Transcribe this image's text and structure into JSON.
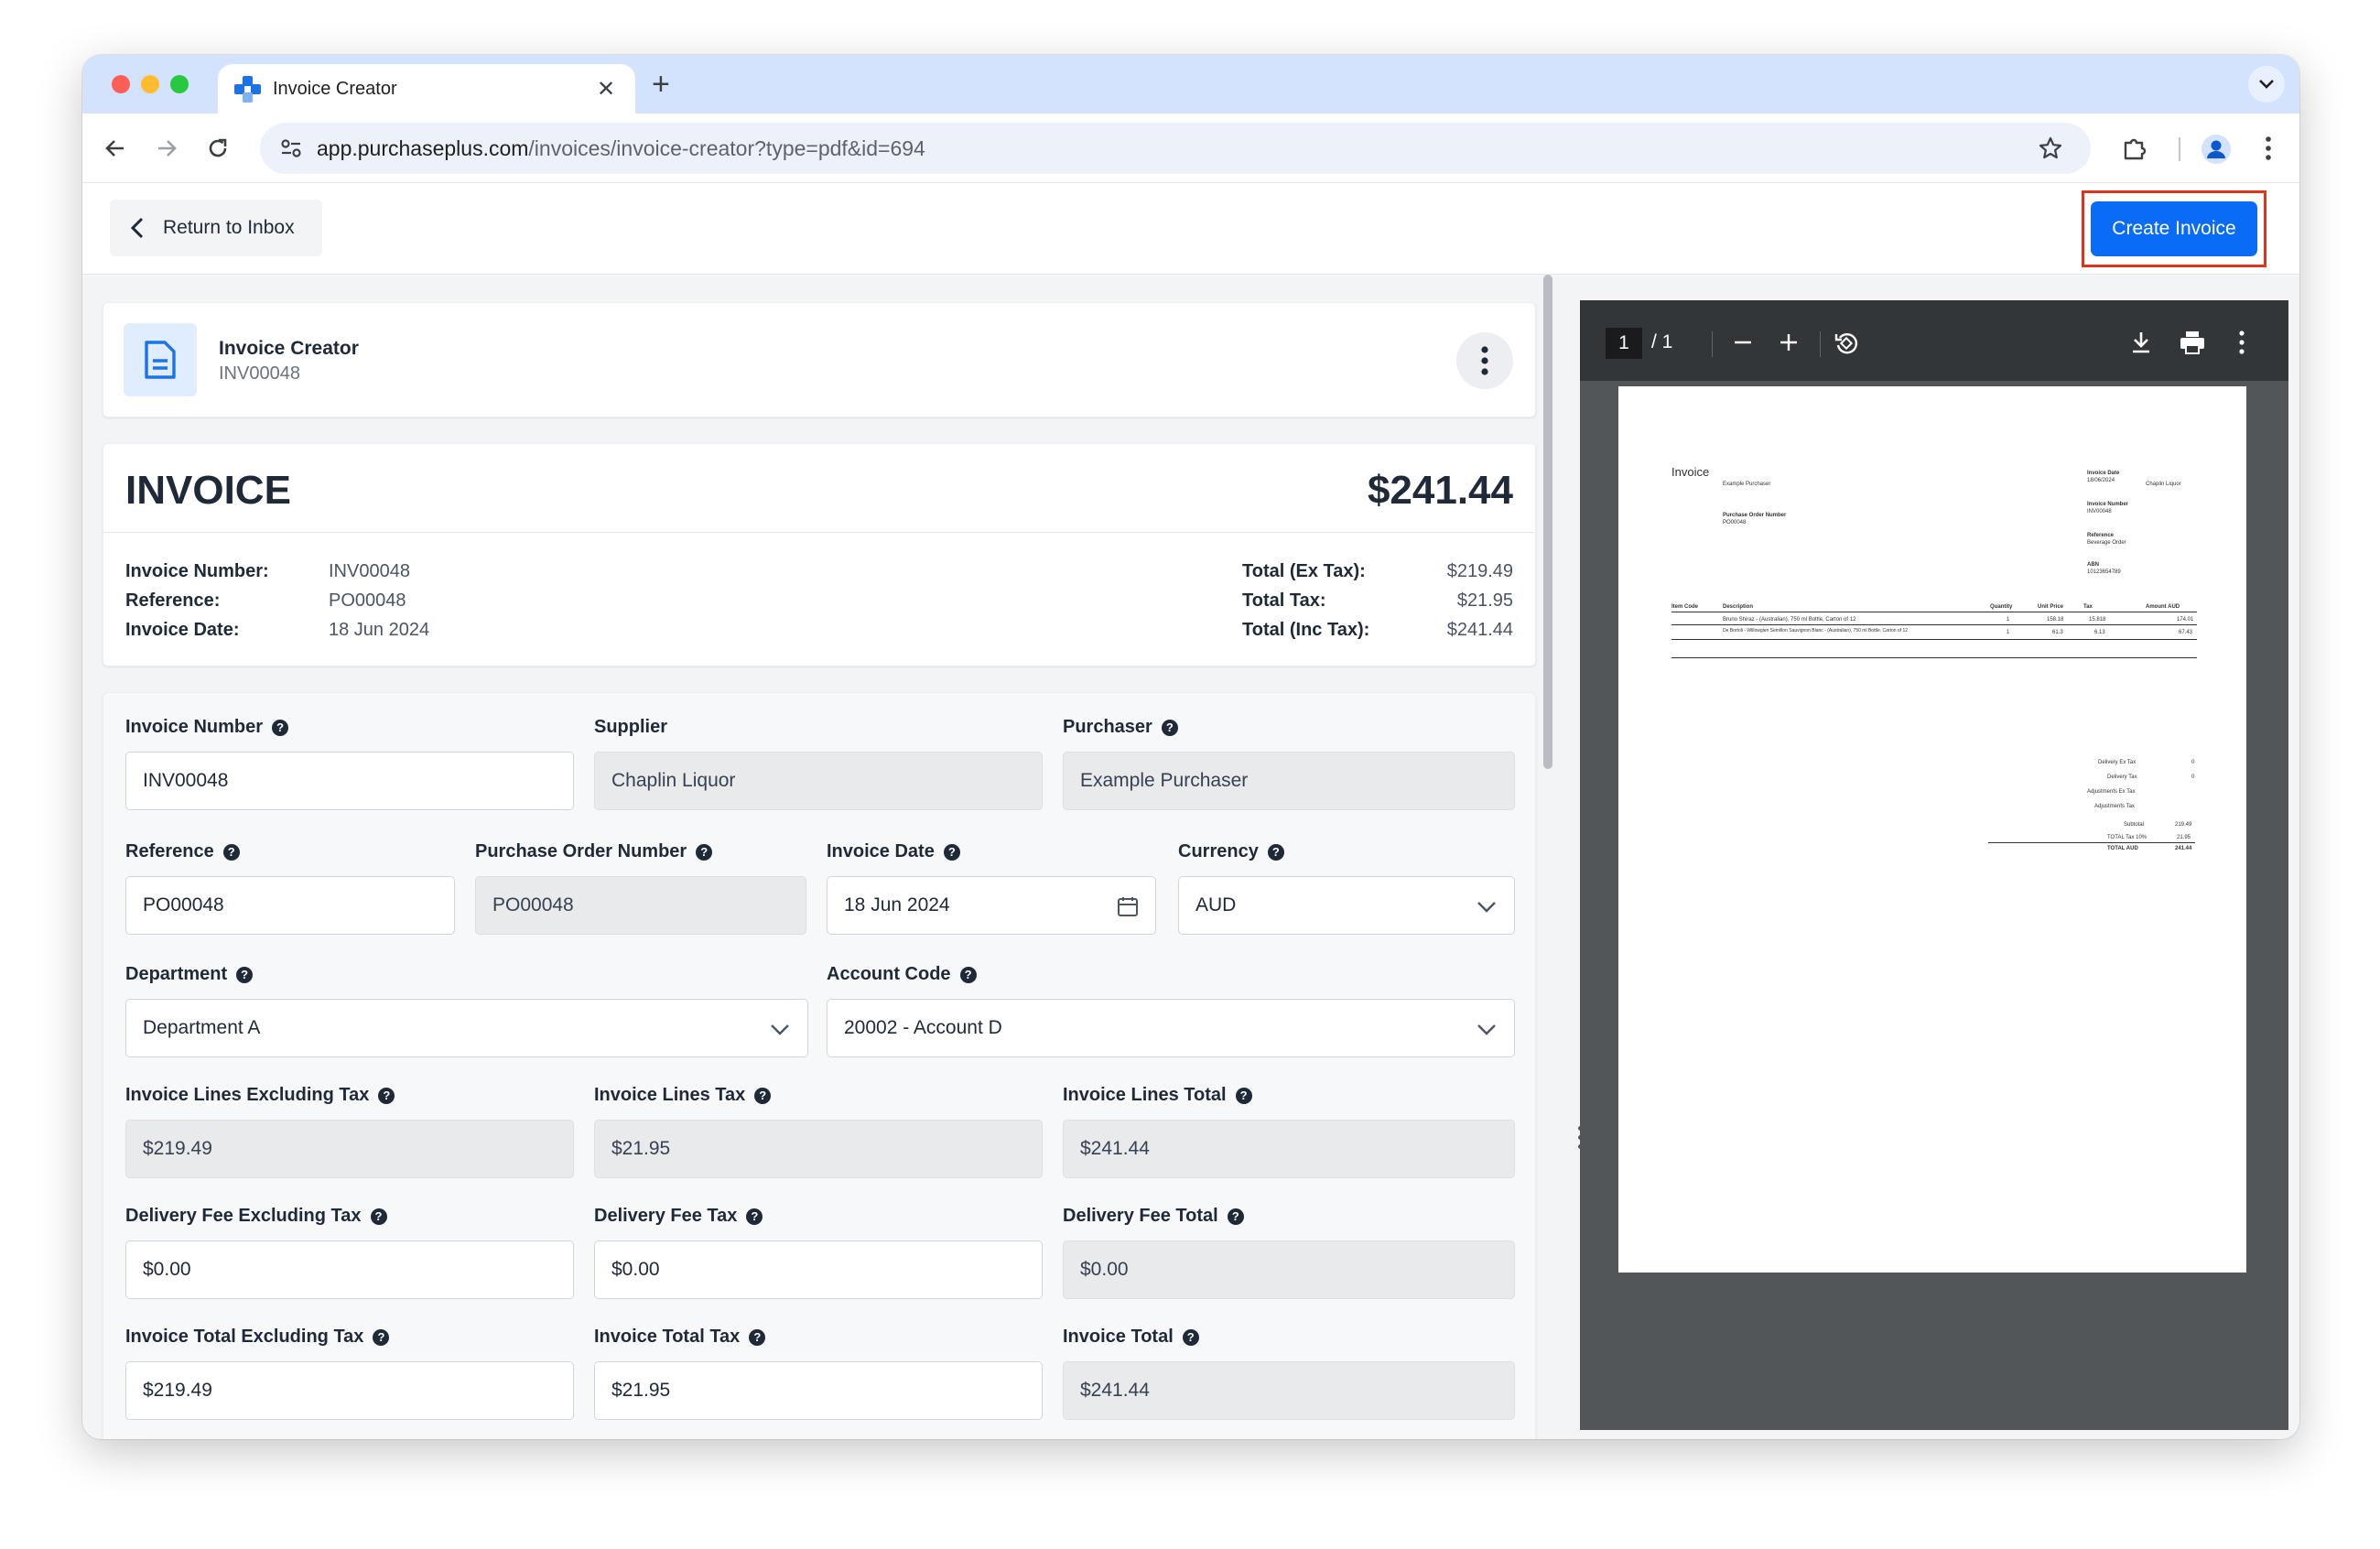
{
  "browser": {
    "tab_title": "Invoice Creator",
    "url_host": "app.purchaseplus.com",
    "url_path": "/invoices/invoice-creator?type=pdf&id=694"
  },
  "header": {
    "return_label": "Return to Inbox",
    "create_label": "Create Invoice"
  },
  "invoice_header": {
    "title": "Invoice Creator",
    "subtitle": "INV00048"
  },
  "summary": {
    "title": "INVOICE",
    "total": "$241.44",
    "left": [
      {
        "label": "Invoice Number:",
        "value": "INV00048"
      },
      {
        "label": "Reference:",
        "value": "PO00048"
      },
      {
        "label": "Invoice Date:",
        "value": "18 Jun 2024"
      }
    ],
    "right": [
      {
        "label": "Total (Ex Tax):",
        "value": "$219.49"
      },
      {
        "label": "Total Tax:",
        "value": "$21.95"
      },
      {
        "label": "Total (Inc Tax):",
        "value": "$241.44"
      }
    ]
  },
  "form": {
    "invoice_number": {
      "label": "Invoice Number",
      "value": "INV00048"
    },
    "supplier": {
      "label": "Supplier",
      "value": "Chaplin Liquor"
    },
    "purchaser": {
      "label": "Purchaser",
      "value": "Example Purchaser"
    },
    "reference": {
      "label": "Reference",
      "value": "PO00048"
    },
    "po_number": {
      "label": "Purchase Order Number",
      "value": "PO00048"
    },
    "invoice_date": {
      "label": "Invoice Date",
      "value": "18 Jun 2024"
    },
    "currency": {
      "label": "Currency",
      "value": "AUD"
    },
    "department": {
      "label": "Department",
      "value": "Department A"
    },
    "account_code": {
      "label": "Account Code",
      "value": "20002 - Account D"
    },
    "lines_ex_tax": {
      "label": "Invoice Lines Excluding Tax",
      "value": "$219.49"
    },
    "lines_tax": {
      "label": "Invoice Lines Tax",
      "value": "$21.95"
    },
    "lines_total": {
      "label": "Invoice Lines Total",
      "value": "$241.44"
    },
    "delivery_ex_tax": {
      "label": "Delivery Fee Excluding Tax",
      "value": "$0.00"
    },
    "delivery_tax": {
      "label": "Delivery Fee Tax",
      "value": "$0.00"
    },
    "delivery_total": {
      "label": "Delivery Fee Total",
      "value": "$0.00"
    },
    "total_ex_tax": {
      "label": "Invoice Total Excluding Tax",
      "value": "$219.49"
    },
    "total_tax": {
      "label": "Invoice Total Tax",
      "value": "$21.95"
    },
    "total": {
      "label": "Invoice Total",
      "value": "$241.44"
    }
  },
  "pdf": {
    "page_current": "1",
    "page_total": "/ 1",
    "doc": {
      "title": "Invoice",
      "purchaser": "Example Purchaser",
      "po_label": "Purchase Order Number",
      "po_value": "PO00048",
      "date_label": "Invoice Date",
      "date_value": "18/06/2024",
      "supplier": "Chaplin Liquor",
      "num_label": "Invoice Number",
      "num_value": "INV00048",
      "ref_label": "Reference",
      "ref_value": "Beverage Order",
      "abn_label": "ABN",
      "abn_value": "10123654789",
      "cols": [
        "Item Code",
        "Description",
        "Quantity",
        "Unit Price",
        "Tax",
        "Amount AUD"
      ],
      "rows": [
        [
          "",
          "Bruno Shiraz - (Australian), 750 ml Bottle, Carton of 12",
          "1",
          "158.18",
          "15.818",
          "174.01"
        ],
        [
          "",
          "De Bortoli - Willowglen Semillon Sauvignon Blanc - (Australian), 750 ml Bottle, Carton of 12",
          "1",
          "61.3",
          "6.13",
          "67.43"
        ]
      ],
      "totals": [
        {
          "label": "Delivery Ex Tax",
          "value": "0"
        },
        {
          "label": "Delivery Tax",
          "value": "0"
        },
        {
          "label": "Adjustments Ex Tax",
          "value": ""
        },
        {
          "label": "Adjustments Tax",
          "value": ""
        },
        {
          "label": "Subtotal",
          "value": "219.49"
        },
        {
          "label": "TOTAL Tax 10%",
          "value": "21.95"
        },
        {
          "label": "TOTAL AUD",
          "value": "241.44"
        }
      ]
    }
  },
  "colors": {
    "primary": "#0a6cf5",
    "highlight_frame": "#e0331b",
    "tabstrip": "#d3e3fd"
  }
}
